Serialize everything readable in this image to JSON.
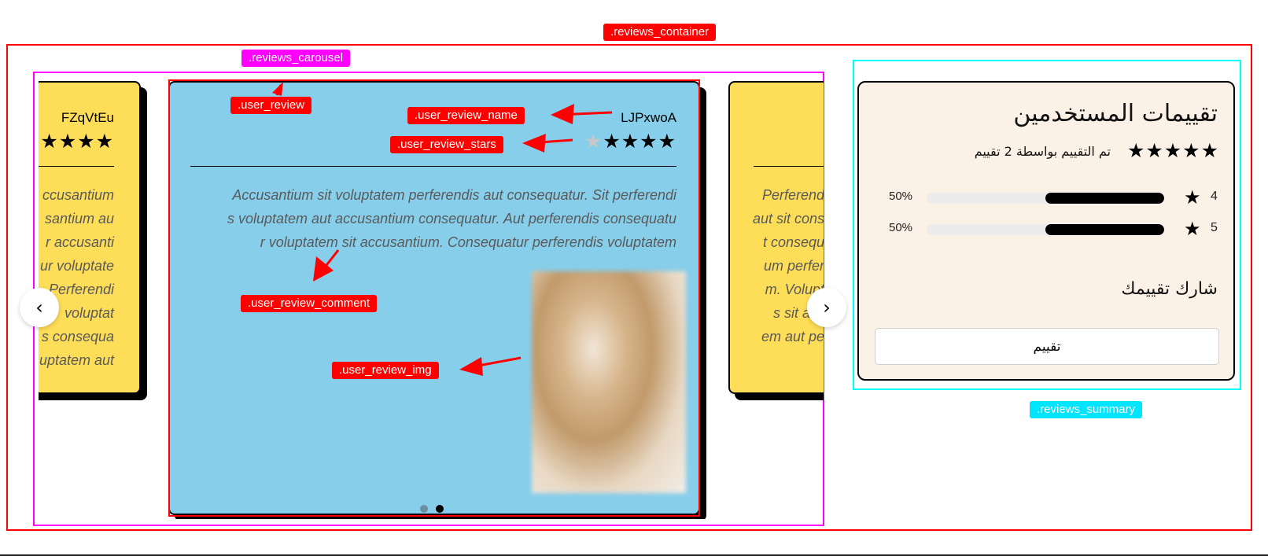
{
  "labels": {
    "reviews_container": ".reviews_container",
    "reviews_carousel": ".reviews_carousel",
    "reviews_summary": ".reviews_summary",
    "user_review": ".user_review",
    "user_review_name": ".user_review_name",
    "user_review_stars": ".user_review_stars",
    "user_review_comment": ".user_review_comment",
    "user_review_img": ".user_review_img"
  },
  "carousel": {
    "left_card": {
      "name": "FZqVtEu",
      "stars": "★★★★",
      "comment_lines": [
        "ccusantium",
        "santium au",
        "r accusanti",
        "ur voluptate",
        "Perferendi",
        "voluptat",
        "s consequa",
        "uptatem aut"
      ]
    },
    "center_card": {
      "name": "LJPxwoA",
      "stars_filled": "★★★★",
      "stars_empty": "★",
      "comment_lines": [
        "Accusantium sit voluptatem perferendis aut consequatur. Sit perferendi",
        "s voluptatem aut accusantium consequatur. Aut perferendis consequatu",
        "r voluptatem sit accusantium. Consequatur perferendis voluptatem"
      ]
    },
    "right_card": {
      "comment_lines": [
        "Perferend",
        "aut sit cons",
        "t consequ",
        "um perfer",
        "m. Volupt",
        "s sit acc",
        "em aut pe"
      ]
    },
    "prev_icon": "‹",
    "next_icon": "›",
    "dots": {
      "count": 2,
      "active_index": 1
    }
  },
  "summary": {
    "title": "تقييمات المستخدمين",
    "stars": "★★★★★",
    "subtitle": "تم التقييم بواسطة 2 تقييم",
    "rows": [
      {
        "stars": "4",
        "percent_label": "50%",
        "fraction": 0.5
      },
      {
        "stars": "5",
        "percent_label": "50%",
        "fraction": 0.5
      }
    ],
    "row_star_icon": "★",
    "share_label": "شارك تقييمك",
    "rate_button": "تقييم"
  },
  "colors": {
    "annotation_red": "#ff0000",
    "annotation_magenta": "#ff00ff",
    "annotation_cyan": "#00e5ff",
    "card_yellow": "#fedd58",
    "card_blue": "#87ceeb",
    "summary_bg": "#fcf1e6"
  }
}
